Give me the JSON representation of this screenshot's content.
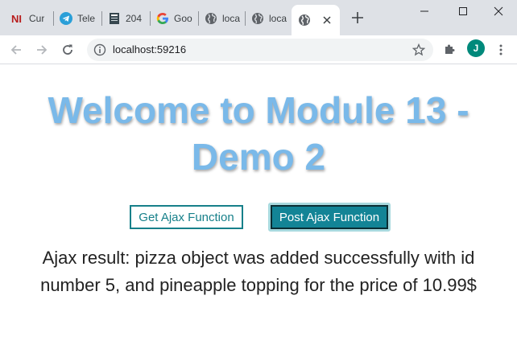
{
  "browser": {
    "tabs": [
      {
        "title": "Cur",
        "icon": "ni-logo-icon"
      },
      {
        "title": "Tele",
        "icon": "telegram-icon"
      },
      {
        "title": "204",
        "icon": "book-icon"
      },
      {
        "title": "Goo",
        "icon": "google-icon"
      },
      {
        "title": "loca",
        "icon": "globe-icon"
      },
      {
        "title": "loca",
        "icon": "globe-icon"
      },
      {
        "title": "",
        "icon": "globe-icon",
        "active": true
      }
    ],
    "address": "localhost:59216",
    "profile_initial": "J",
    "colors": {
      "tabstrip": "#dee1e6",
      "omnibox": "#f1f3f4",
      "avatar": "#00897b"
    }
  },
  "page": {
    "heading_line1": "Welcome to Module 13 -",
    "heading_line2": "Demo 2",
    "get_button_label": "Get Ajax Function",
    "post_button_label": "Post Ajax Function",
    "result_line1": "Ajax result: pizza object was added successfully with id",
    "result_line2": "number 5, and pineapple topping for the price of 10.99$",
    "colors": {
      "heading": "#7ab9e9",
      "button_teal": "#138496",
      "button_outline": "#17808a"
    }
  }
}
